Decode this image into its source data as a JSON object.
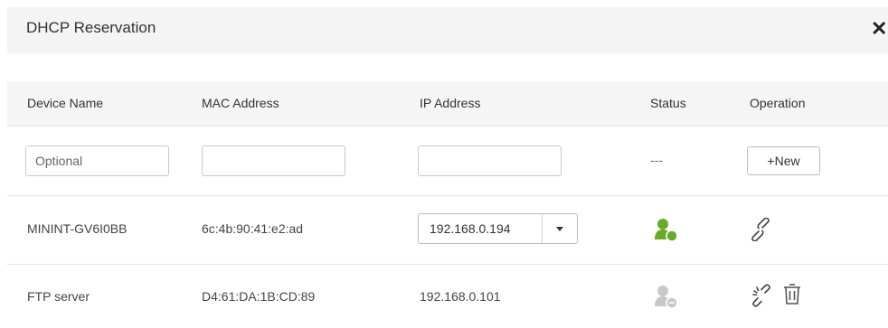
{
  "dialog": {
    "title": "DHCP Reservation",
    "close_icon": "close-icon"
  },
  "table": {
    "headers": [
      "Device Name",
      "MAC Address",
      "IP Address",
      "Status",
      "Operation"
    ],
    "new_row": {
      "device_name_placeholder": "Optional",
      "device_name_value": "",
      "mac_value": "",
      "ip_value": "",
      "status": "---",
      "new_label": "+New"
    },
    "rows": [
      {
        "device_name": "MININT-GV6I0BB",
        "mac": "6c:4b:90:41:e2:ad",
        "ip": "192.168.0.194",
        "ip_is_select": true,
        "status_icon": "user-online-icon",
        "status_color": "#6aaa2a",
        "operations": [
          "link-icon"
        ]
      },
      {
        "device_name": "FTP server",
        "mac": "D4:61:DA:1B:CD:89",
        "ip": "192.168.0.101",
        "ip_is_select": false,
        "status_icon": "user-offline-icon",
        "status_color": "#c8c8c8",
        "operations": [
          "unlink-icon",
          "trash-icon"
        ]
      }
    ]
  }
}
